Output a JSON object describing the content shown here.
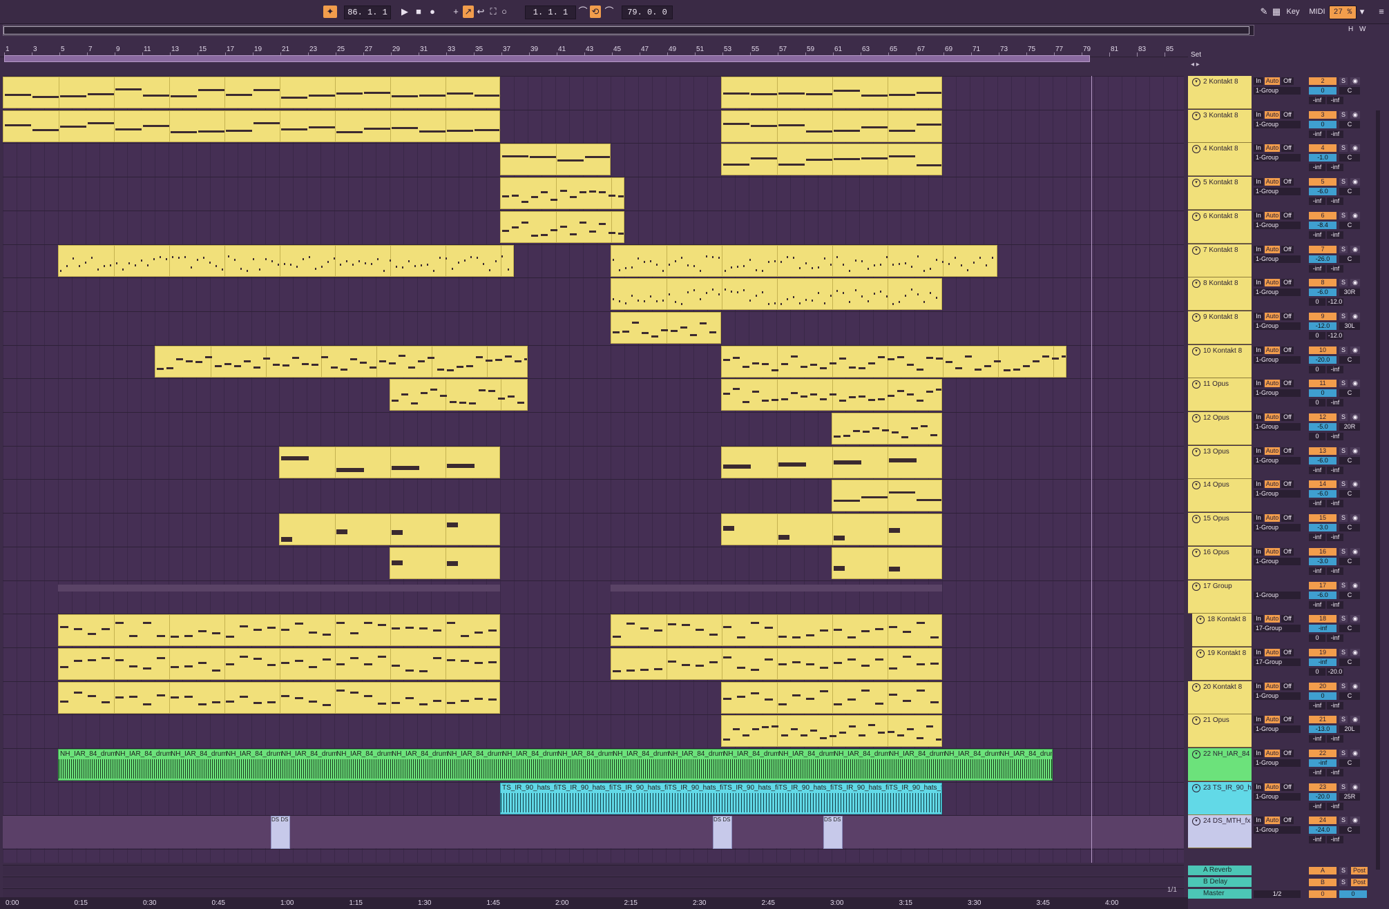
{
  "transport": {
    "tempo_pos": "86. 1. 1",
    "loop_start": "1. 1. 1",
    "loop_len": "79. 0. 0",
    "key_label": "Key",
    "midi_label": "MIDI",
    "cpu": "27 %"
  },
  "set_label": "Set",
  "overview_buttons": [
    "H",
    "W"
  ],
  "bars": [
    "1",
    "3",
    "5",
    "7",
    "9",
    "11",
    "13",
    "15",
    "17",
    "19",
    "21",
    "23",
    "25",
    "27",
    "29",
    "31",
    "33",
    "35",
    "37",
    "39",
    "41",
    "43",
    "45",
    "47",
    "49",
    "51",
    "53",
    "55",
    "57",
    "59",
    "61",
    "63",
    "65",
    "67",
    "69",
    "71",
    "73",
    "75",
    "77",
    "79",
    "81",
    "83",
    "85"
  ],
  "times": [
    "0:00",
    "0:15",
    "0:30",
    "0:45",
    "1:00",
    "1:15",
    "1:30",
    "1:45",
    "2:00",
    "2:15",
    "2:30",
    "2:45",
    "3:00",
    "3:15",
    "3:30",
    "3:45",
    "4:00"
  ],
  "tracks": [
    {
      "name": "2 Kontakt 8",
      "num": "2",
      "route": "1-Group",
      "vol": "0",
      "pan": "C",
      "m1": "-inf",
      "m2": "-inf"
    },
    {
      "name": "3 Kontakt 8",
      "num": "3",
      "route": "1-Group",
      "vol": "0",
      "pan": "C",
      "m1": "-inf",
      "m2": "-inf"
    },
    {
      "name": "4 Kontakt 8",
      "num": "4",
      "route": "1-Group",
      "vol": "-1.0",
      "pan": "C",
      "m1": "-inf",
      "m2": "-inf"
    },
    {
      "name": "5 Kontakt 8",
      "num": "5",
      "route": "1-Group",
      "vol": "-6.0",
      "pan": "C",
      "m1": "-inf",
      "m2": "-inf"
    },
    {
      "name": "6 Kontakt 8",
      "num": "6",
      "route": "1-Group",
      "vol": "-8.4",
      "pan": "C",
      "m1": "-inf",
      "m2": "-inf"
    },
    {
      "name": "7 Kontakt 8",
      "num": "7",
      "route": "1-Group",
      "vol": "-26.0",
      "pan": "C",
      "m1": "-inf",
      "m2": "-inf"
    },
    {
      "name": "8 Kontakt 8",
      "num": "8",
      "route": "1-Group",
      "vol": "-6.0",
      "pan": "30R",
      "m1": "0",
      "m2": "-12.0"
    },
    {
      "name": "9 Kontakt 8",
      "num": "9",
      "route": "1-Group",
      "vol": "-12.0",
      "pan": "30L",
      "m1": "0",
      "m2": "-12.0"
    },
    {
      "name": "10 Kontakt 8",
      "num": "10",
      "route": "1-Group",
      "vol": "-20.0",
      "pan": "C",
      "m1": "0",
      "m2": "-inf"
    },
    {
      "name": "11 Opus",
      "num": "11",
      "route": "1-Group",
      "vol": "0",
      "pan": "C",
      "m1": "0",
      "m2": "-inf"
    },
    {
      "name": "12 Opus",
      "num": "12",
      "route": "1-Group",
      "vol": "-5.0",
      "pan": "20R",
      "m1": "0",
      "m2": "-inf"
    },
    {
      "name": "13 Opus",
      "num": "13",
      "route": "1-Group",
      "vol": "-6.0",
      "pan": "C",
      "m1": "-inf",
      "m2": "-inf"
    },
    {
      "name": "14 Opus",
      "num": "14",
      "route": "1-Group",
      "vol": "-6.0",
      "pan": "C",
      "m1": "-inf",
      "m2": "-inf"
    },
    {
      "name": "15 Opus",
      "num": "15",
      "route": "1-Group",
      "vol": "-3.0",
      "pan": "C",
      "m1": "-inf",
      "m2": "-inf"
    },
    {
      "name": "16 Opus",
      "num": "16",
      "route": "1-Group",
      "vol": "-3.0",
      "pan": "C",
      "m1": "-inf",
      "m2": "-inf"
    },
    {
      "name": "17 Group",
      "num": "17",
      "route": "1-Group",
      "vol": "-6.0",
      "pan": "C",
      "m1": "-inf",
      "m2": "-inf"
    },
    {
      "name": "18 Kontakt 8",
      "num": "18",
      "route": "17-Group",
      "vol": "-inf",
      "pan": "C",
      "m1": "0",
      "m2": "-inf"
    },
    {
      "name": "19 Kontakt 8",
      "num": "19",
      "route": "17-Group",
      "vol": "-inf",
      "pan": "C",
      "m1": "0",
      "m2": "-20.0"
    },
    {
      "name": "20 Kontakt 8",
      "num": "20",
      "route": "1-Group",
      "vol": "0",
      "pan": "C",
      "m1": "-inf",
      "m2": "-inf"
    },
    {
      "name": "21 Opus",
      "num": "21",
      "route": "1-Group",
      "vol": "-13.0",
      "pan": "20L",
      "m1": "-inf",
      "m2": "-inf"
    },
    {
      "name": "22 NH_IAR_84",
      "num": "22",
      "route": "1-Group",
      "vol": "-inf",
      "pan": "C",
      "m1": "-inf",
      "m2": "-inf"
    },
    {
      "name": "23 TS_IR_90_h",
      "num": "23",
      "route": "1-Group",
      "vol": "-20.0",
      "pan": "25R",
      "m1": "-inf",
      "m2": "-inf"
    },
    {
      "name": "24 DS_MTH_fx",
      "num": "24",
      "route": "1-Group",
      "vol": "-24.0",
      "pan": "C",
      "m1": "-inf",
      "m2": "-inf"
    }
  ],
  "btn": {
    "in": "In",
    "auto": "Auto",
    "off": "Off",
    "s": "S",
    "post": "Post"
  },
  "returns": [
    {
      "name": "A Reverb",
      "num": "A",
      "post": "Post"
    },
    {
      "name": "B Delay",
      "num": "B",
      "post": "Post"
    },
    {
      "name": "Master",
      "num": "0",
      "route": "1/2",
      "vol": "0"
    }
  ],
  "audio_labels": {
    "green": "NH_IAR_84_drum",
    "cyan": "TS_IR_90_hats_fi",
    "fx": "DS DS"
  },
  "colors": {
    "midi_clip": "#f1e07a",
    "audio_green": "#6ce27b",
    "audio_cyan": "#62d9e7",
    "accent": "#f29d4c",
    "bg": "#3d2c49"
  },
  "page_indicator": "1/1"
}
